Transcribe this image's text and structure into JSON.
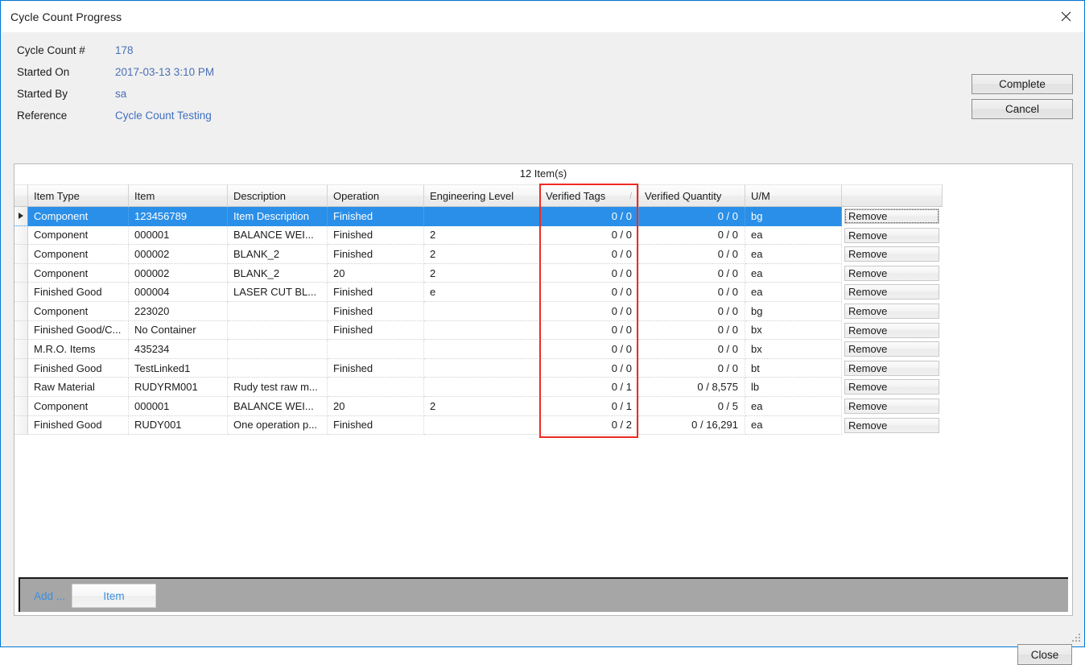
{
  "window": {
    "title": "Cycle Count Progress",
    "close_icon": "close-x-icon"
  },
  "header": {
    "fields": [
      {
        "label": "Cycle Count #",
        "value": "178"
      },
      {
        "label": "Started On",
        "value": "2017-03-13 3:10 PM"
      },
      {
        "label": "Started By",
        "value": "sa"
      },
      {
        "label": "Reference",
        "value": "Cycle Count Testing"
      }
    ],
    "complete_button": "Complete",
    "cancel_button": "Cancel"
  },
  "grid": {
    "item_count": "12 Item(s)",
    "sort_indicator": "/",
    "columns": [
      "Item Type",
      "Item",
      "Description",
      "Operation",
      "Engineering Level",
      "Verified Tags",
      "Verified Quantity",
      "U/M",
      ""
    ],
    "action_label": "Remove",
    "rows": [
      {
        "item_type": "Component",
        "item": "123456789",
        "description": "Item Description",
        "operation": "Finished",
        "engineering_level": "",
        "verified_tags": "0 / 0",
        "verified_quantity": "0 / 0",
        "um": "bg",
        "action": "Remove",
        "selected": true
      },
      {
        "item_type": "Component",
        "item": "000001",
        "description": "BALANCE  WEI...",
        "operation": "Finished",
        "engineering_level": "2",
        "verified_tags": "0 / 0",
        "verified_quantity": "0 / 0",
        "um": "ea",
        "action": "Remove",
        "selected": false
      },
      {
        "item_type": "Component",
        "item": "000002",
        "description": "BLANK_2",
        "operation": "Finished",
        "engineering_level": "2",
        "verified_tags": "0 / 0",
        "verified_quantity": "0 / 0",
        "um": "ea",
        "action": "Remove",
        "selected": false
      },
      {
        "item_type": "Component",
        "item": "000002",
        "description": "BLANK_2",
        "operation": "20",
        "engineering_level": "2",
        "verified_tags": "0 / 0",
        "verified_quantity": "0 / 0",
        "um": "ea",
        "action": "Remove",
        "selected": false
      },
      {
        "item_type": "Finished Good",
        "item": "000004",
        "description": "LASER  CUT  BL...",
        "operation": "Finished",
        "engineering_level": "e",
        "verified_tags": "0 / 0",
        "verified_quantity": "0 / 0",
        "um": "ea",
        "action": "Remove",
        "selected": false
      },
      {
        "item_type": "Component",
        "item": "223020",
        "description": "",
        "operation": "Finished",
        "engineering_level": "",
        "verified_tags": "0 / 0",
        "verified_quantity": "0 / 0",
        "um": "bg",
        "action": "Remove",
        "selected": false
      },
      {
        "item_type": "Finished Good/C...",
        "item": "No Container",
        "description": "",
        "operation": "Finished",
        "engineering_level": "",
        "verified_tags": "0 / 0",
        "verified_quantity": "0 / 0",
        "um": "bx",
        "action": "Remove",
        "selected": false
      },
      {
        "item_type": "M.R.O. Items",
        "item": "435234",
        "description": "",
        "operation": "",
        "engineering_level": "",
        "verified_tags": "0 / 0",
        "verified_quantity": "0 / 0",
        "um": "bx",
        "action": "Remove",
        "selected": false
      },
      {
        "item_type": "Finished Good",
        "item": "TestLinked1",
        "description": "",
        "operation": "Finished",
        "engineering_level": "",
        "verified_tags": "0 / 0",
        "verified_quantity": "0 / 0",
        "um": "bt",
        "action": "Remove",
        "selected": false
      },
      {
        "item_type": "Raw Material",
        "item": "RUDYRM001",
        "description": "Rudy test raw m...",
        "operation": "",
        "engineering_level": "",
        "verified_tags": "0 / 1",
        "verified_quantity": "0 / 8,575",
        "um": "lb",
        "action": "Remove",
        "selected": false
      },
      {
        "item_type": "Component",
        "item": "000001",
        "description": "BALANCE  WEI...",
        "operation": "20",
        "engineering_level": "2",
        "verified_tags": "0 / 1",
        "verified_quantity": "0 / 5",
        "um": "ea",
        "action": "Remove",
        "selected": false
      },
      {
        "item_type": "Finished Good",
        "item": "RUDY001",
        "description": "One operation p...",
        "operation": "Finished",
        "engineering_level": "",
        "verified_tags": "0 / 2",
        "verified_quantity": "0 / 16,291",
        "um": "ea",
        "action": "Remove",
        "selected": false
      }
    ]
  },
  "toolbar": {
    "add_label": "Add ...",
    "item_button": "Item"
  },
  "footer": {
    "close_button": "Close"
  },
  "colors": {
    "accent": "#0078d7",
    "selection": "#2a8fe8",
    "annotation": "#ee2b24",
    "link": "#4a6fb5",
    "toolbar_bg": "#a6a6a6"
  }
}
